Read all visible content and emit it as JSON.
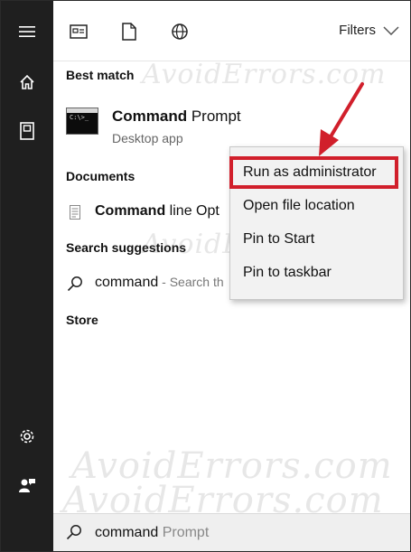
{
  "rail": {
    "items": [
      {
        "name": "hamburger-menu-icon"
      },
      {
        "name": "home-icon"
      },
      {
        "name": "documents-icon"
      },
      {
        "name": "settings-gear-icon"
      },
      {
        "name": "user-feedback-icon"
      }
    ]
  },
  "toolbar": {
    "filters_label": "Filters"
  },
  "results": {
    "best_match_header": "Best match",
    "best_match": {
      "title_bold": "Command",
      "title_rest": " Prompt",
      "subtitle": "Desktop app",
      "icon_text": "C:\\>_"
    },
    "documents_header": "Documents",
    "document_item": {
      "bold": "Command",
      "rest": " line Opt"
    },
    "suggestions_header": "Search suggestions",
    "suggestion_item": {
      "term": "command",
      "hint": " - Search th"
    },
    "store_header": "Store"
  },
  "context_menu": {
    "items": [
      "Run as administrator",
      "Open file location",
      "Pin to Start",
      "Pin to taskbar"
    ],
    "highlighted_index": 0,
    "highlight_color": "#d11f2b"
  },
  "search": {
    "typed": "command",
    "suggested": " Prompt"
  },
  "watermark": "AvoidErrors.com",
  "colors": {
    "rail_bg": "#1f1f1f",
    "accent_red": "#d11f2b",
    "menu_bg": "#f2f2f2"
  }
}
